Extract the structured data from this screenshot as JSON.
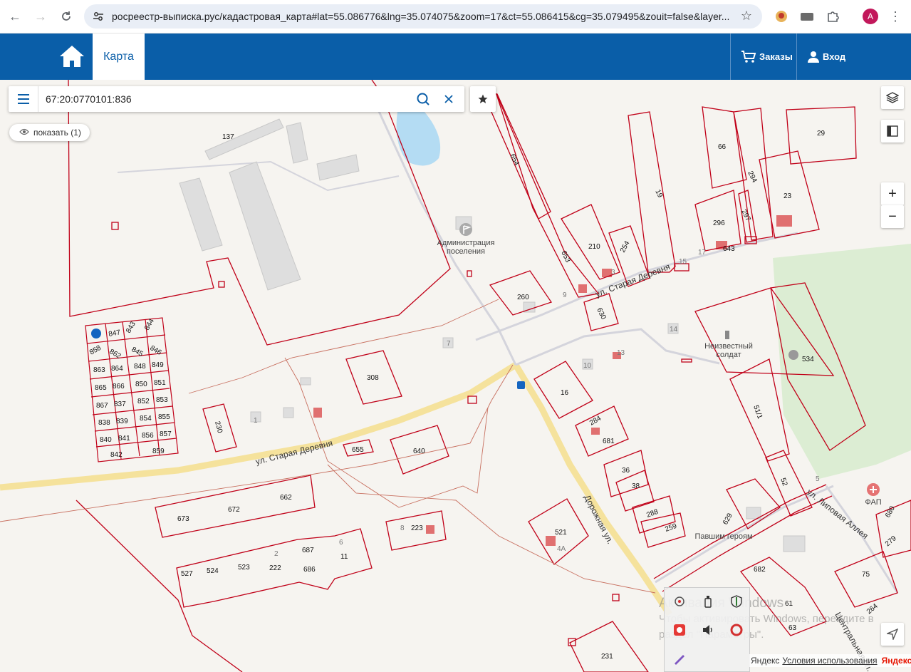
{
  "browser": {
    "url": "росреестр-выписка.рус/кадастровая_карта#lat=55.086776&lng=35.074075&zoom=17&ct=55.086415&cg=35.079495&zouit=false&layer...",
    "avatar_letter": "A"
  },
  "header": {
    "map_tab": "Карта",
    "orders": "Заказы",
    "login": "Вход"
  },
  "search": {
    "value": "67:20:0770101:836"
  },
  "show_button": "показать (1)",
  "zoom": {
    "in": "+",
    "out": "−"
  },
  "streets": {
    "old_village_w": "ул. Старая Деревня",
    "old_village_e": "ул. Старая Деревня",
    "road": "Дорожная ул.",
    "central": "Центральная ул.",
    "lipovaya": "ул. Липовая Аллея"
  },
  "pois": {
    "admin_1": "Администрация",
    "admin_2": "поселения",
    "soldier_1": "Неизвестный",
    "soldier_2": "солдат",
    "fap": "ФАП",
    "fallen": "Павшим героям"
  },
  "parcels": [
    "137",
    "654",
    "210",
    "254",
    "19",
    "66",
    "294",
    "29",
    "23",
    "296",
    "297",
    "643",
    "15",
    "17",
    "653",
    "9",
    "3",
    "260",
    "630",
    "14",
    "534",
    "7",
    "10",
    "13",
    "16",
    "1",
    "308",
    "847",
    "858",
    "862",
    "863",
    "864",
    "865",
    "866",
    "867",
    "837",
    "838",
    "839",
    "840",
    "841",
    "842",
    "843",
    "844",
    "845",
    "846",
    "848",
    "849",
    "850",
    "851",
    "852",
    "853",
    "854",
    "855",
    "856",
    "857",
    "859",
    "230",
    "655",
    "640",
    "284",
    "681",
    "36",
    "38",
    "288",
    "259",
    "521",
    "4А",
    "673",
    "672",
    "662",
    "223",
    "8",
    "6",
    "11",
    "687",
    "686",
    "2",
    "222",
    "527",
    "524",
    "523",
    "51/1",
    "52",
    "629",
    "682",
    "61",
    "63",
    "75",
    "264",
    "279",
    "680",
    "231",
    "5"
  ],
  "watermark": {
    "line1": "Активация Windows",
    "line2": "Чтобы активировать Windows, перейдите в",
    "line3": "раздел \"Параметры\"."
  },
  "attribution": {
    "provider": "Яндекс",
    "terms": "Условия использования",
    "logo": "Яндекс"
  },
  "colors": {
    "header": "#0a5ea8",
    "parcel_border": "#c00018",
    "road": "#f7e49a",
    "park": "#d9ecd0",
    "water": "#aed8f2"
  }
}
